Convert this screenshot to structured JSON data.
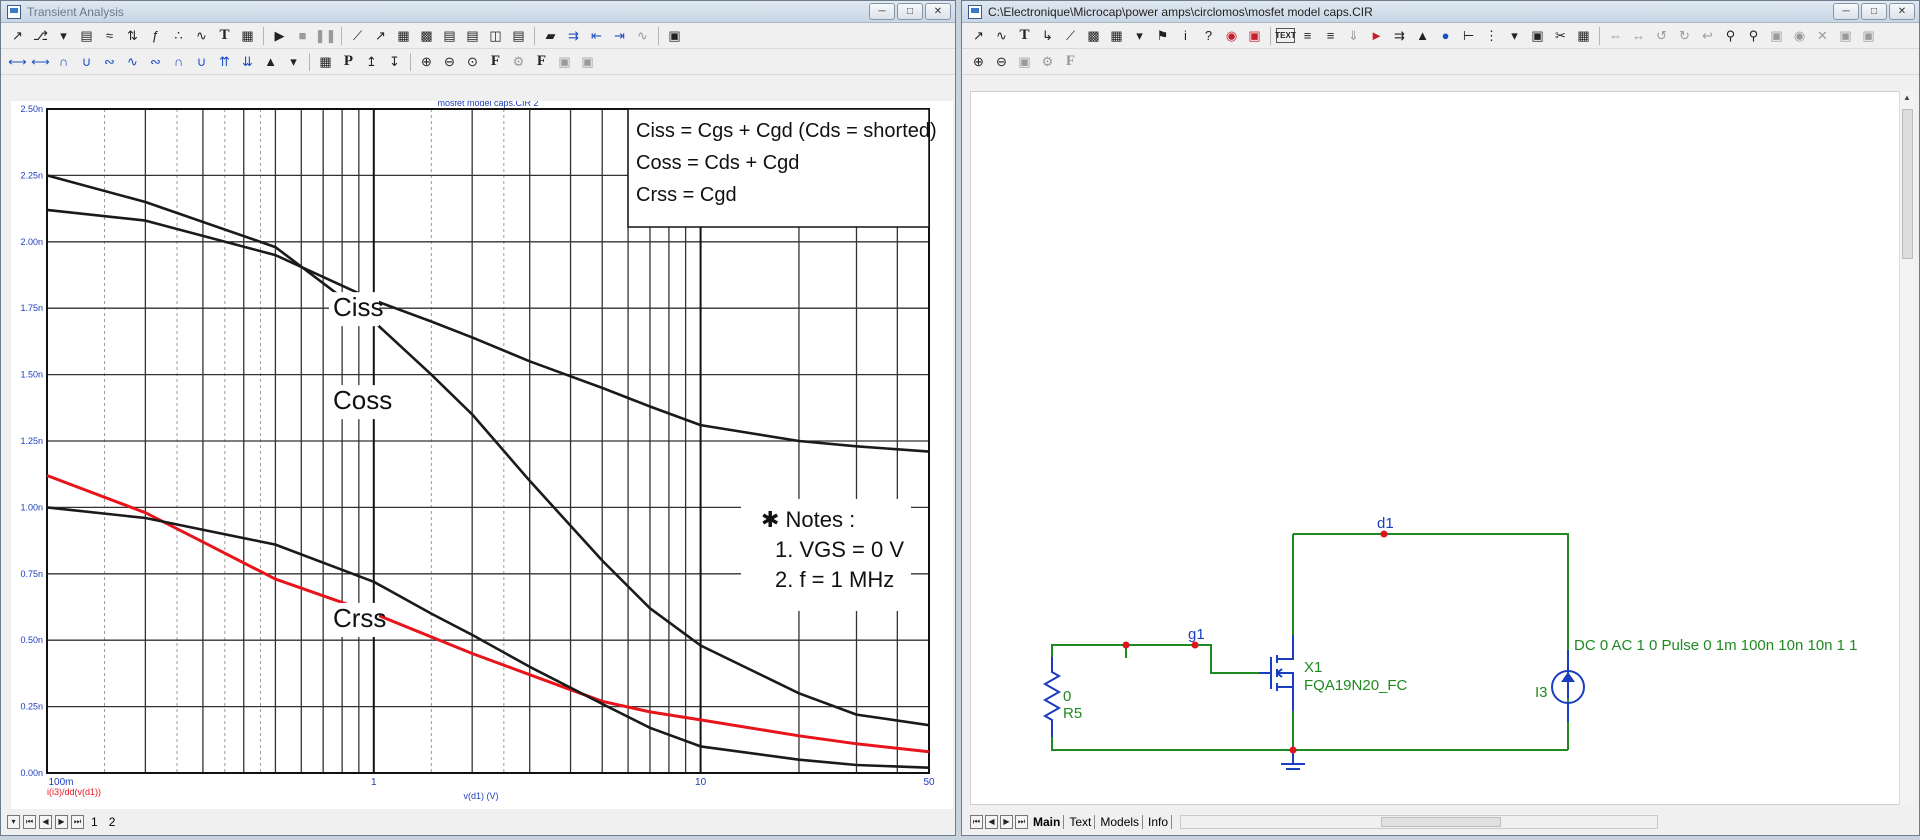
{
  "left_window": {
    "title": "Transient Analysis",
    "status_tabs": [
      "1",
      "2"
    ],
    "plot": {
      "plot_title": "mosfet model caps.CIR 2",
      "y_ticks": [
        "2.50n",
        "2.25n",
        "2.00n",
        "1.75n",
        "1.50n",
        "1.25n",
        "1.00n",
        "0.75n",
        "0.50n",
        "0.25n",
        "0.00n"
      ],
      "x_ticks": [
        "100m",
        "1",
        "10",
        "50"
      ],
      "x_axis_label": "v(d1) (V)",
      "y_expression": "i(i3)/dd(v(d1))",
      "formula_lines": [
        "Ciss = Cgs + Cgd (Cds = shorted)",
        "Coss = Cds + Cgd",
        "Crss = Cgd"
      ],
      "curve_labels": {
        "ciss": "Ciss",
        "coss": "Coss",
        "crss": "Crss"
      },
      "notes_title": "Notes :",
      "notes_lines": [
        "1. VGS = 0 V",
        "2. f = 1 MHz"
      ]
    },
    "colors": {
      "simulated_curve": "#e8141c",
      "datasheet_curves": "#1a1a1a",
      "axis_text": "#1b3dbf"
    }
  },
  "right_window": {
    "title": "C:\\Electronique\\Microcap\\power amps\\circlomos\\mosfet model caps.CIR",
    "tabs": [
      "Main",
      "Text",
      "Models",
      "Info"
    ],
    "active_tab": "Main",
    "schematic": {
      "node_d1": "d1",
      "node_g1": "g1",
      "resistor_value": "0",
      "resistor_name": "R5",
      "mosfet_name": "X1",
      "mosfet_model": "FQA19N20_FC",
      "source_name": "I3",
      "source_spec": "DC 0 AC 1 0 Pulse 0 1m 100n 10n 10n 1 1"
    },
    "colors": {
      "wire": "#1f8a1f",
      "component": "#1b3dbf",
      "node_dot": "#e0141c"
    }
  },
  "chart_data": {
    "type": "line",
    "title": "mosfet model caps.CIR 2",
    "xlabel": "v(d1) (V)",
    "ylabel": "i(i3)/dd(v(d1))",
    "x_scale": "log",
    "xlim": [
      0.1,
      50
    ],
    "ylim": [
      0,
      2.5e-09
    ],
    "grid": true,
    "series": [
      {
        "name": "i(i3)/dd(v(d1))",
        "color": "#e8141c",
        "x": [
          0.1,
          0.2,
          0.3,
          0.5,
          1,
          2,
          3,
          5,
          7,
          10,
          20,
          30,
          50
        ],
        "y": [
          1.12e-09,
          9.8e-10,
          8.7e-10,
          7.3e-10,
          6e-10,
          4.5e-10,
          3.7e-10,
          2.7e-10,
          2.3e-10,
          2e-10,
          1.4e-10,
          1.1e-10,
          8e-11
        ]
      },
      {
        "name": "Ciss",
        "color": "#1a1a1a",
        "x": [
          0.1,
          0.2,
          0.5,
          1,
          1.5,
          2,
          3,
          5,
          7,
          10,
          20,
          30,
          50
        ],
        "y": [
          2.12e-09,
          2.08e-09,
          1.95e-09,
          1.78e-09,
          1.7e-09,
          1.64e-09,
          1.55e-09,
          1.45e-09,
          1.38e-09,
          1.31e-09,
          1.25e-09,
          1.23e-09,
          1.21e-09
        ]
      },
      {
        "name": "Coss",
        "color": "#1a1a1a",
        "x": [
          0.1,
          0.2,
          0.5,
          1,
          1.5,
          2,
          3,
          5,
          7,
          10,
          20,
          30,
          50
        ],
        "y": [
          2.25e-09,
          2.15e-09,
          1.98e-09,
          1.7e-09,
          1.5e-09,
          1.35e-09,
          1.1e-09,
          8e-10,
          6.2e-10,
          4.8e-10,
          3e-10,
          2.2e-10,
          1.8e-10
        ]
      },
      {
        "name": "Crss",
        "color": "#1a1a1a",
        "x": [
          0.1,
          0.2,
          0.5,
          1,
          1.5,
          2,
          3,
          5,
          7,
          10,
          20,
          30,
          50
        ],
        "y": [
          1e-09,
          9.6e-10,
          8.6e-10,
          7.2e-10,
          6e-10,
          5.2e-10,
          4e-10,
          2.6e-10,
          1.7e-10,
          1e-10,
          5e-11,
          3e-11,
          2e-11
        ]
      }
    ]
  }
}
